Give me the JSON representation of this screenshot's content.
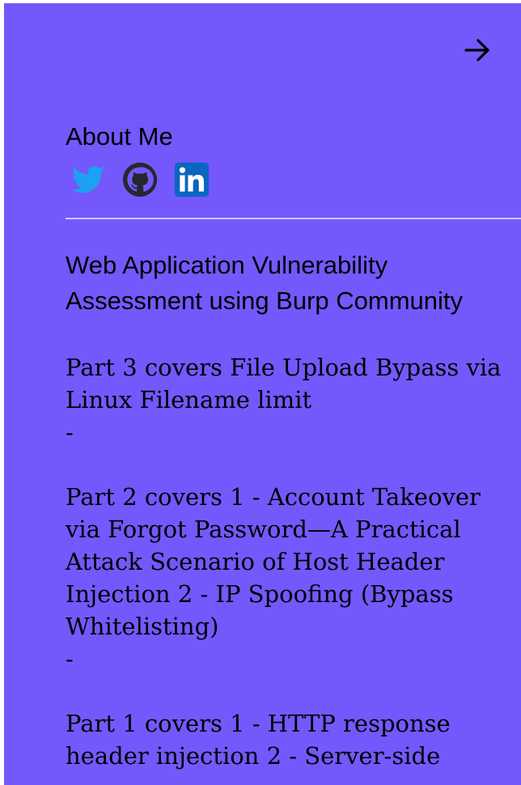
{
  "header": {
    "next_icon": "arrow-right-icon"
  },
  "about": {
    "title": "About Me",
    "social": [
      {
        "name": "Twitter",
        "icon": "twitter-icon",
        "color": "#1da1f2"
      },
      {
        "name": "GitHub",
        "icon": "github-icon",
        "color": "#24292e"
      },
      {
        "name": "LinkedIn",
        "icon": "linkedin-icon",
        "color": "#0a66c2"
      }
    ]
  },
  "post": {
    "title": "Web Application Vulnerability Assessment using Burp Community",
    "parts": [
      {
        "text": "Part 3 covers File Upload Bypass via Linux Filename limit",
        "separator": "-"
      },
      {
        "text": "Part 2 covers 1 - Account Takeover via Forgot Password—A Practical Attack Scenario of Host Header Injection 2 - IP Spoofing (Bypass Whitelisting)",
        "separator": "-"
      },
      {
        "text": "Part 1 covers 1 - HTTP response header injection 2 - Server-side",
        "separator": ""
      }
    ]
  },
  "colors": {
    "panel_background": "#7458fb",
    "divider": "#cfc4fd",
    "text": "#000000"
  }
}
